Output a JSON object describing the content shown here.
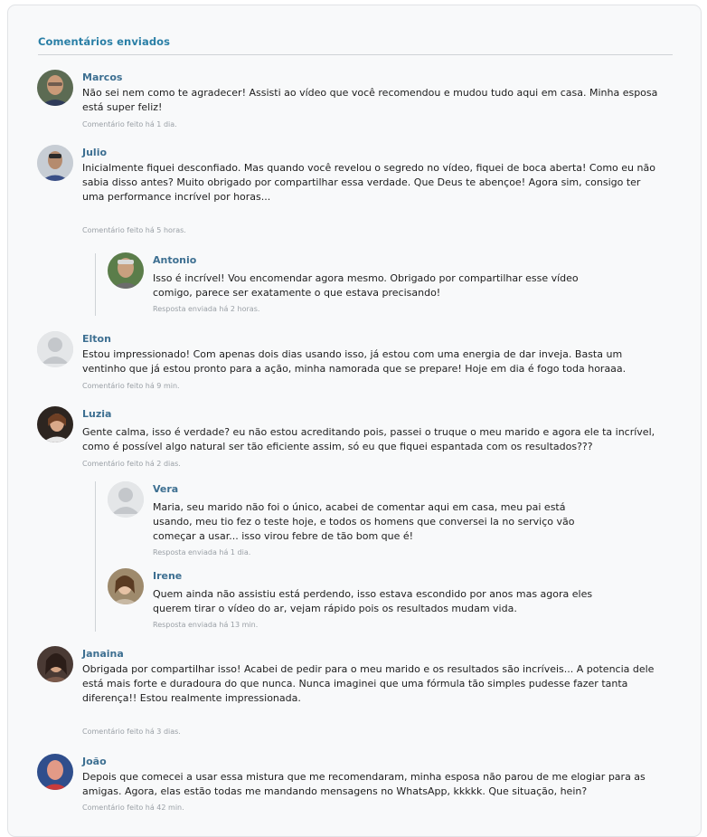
{
  "section_title": "Comentários enviados",
  "comments": [
    {
      "name": "Marcos",
      "text": "Não sei nem como te agradecer! Assisti ao vídeo que você recomendou e mudou tudo aqui em casa. Minha esposa está super feliz!",
      "meta": "Comentário feito há 1 dia."
    },
    {
      "name": "Julio",
      "text": "Inicialmente fiquei desconfiado. Mas quando você revelou o segredo no vídeo, fiquei de boca aberta! Como eu não sabia disso antes? Muito obrigado por compartilhar essa verdade. Que Deus te abençoe! Agora sim, consigo ter uma performance incrível por horas...",
      "meta": "Comentário feito há 5 horas.",
      "replies": [
        {
          "name": "Antonio",
          "text": "Isso é incrível! Vou encomendar agora mesmo. Obrigado por compartilhar esse vídeo comigo, parece ser exatamente o que estava precisando!",
          "meta": "Resposta enviada há 2 horas."
        }
      ]
    },
    {
      "name": "Elton",
      "text": "Estou impressionado! Com apenas dois dias usando isso, já estou com uma energia de dar inveja. Basta um ventinho que já estou pronto para a ação, minha namorada que se prepare! Hoje em dia é fogo toda horaaa.",
      "meta": "Comentário feito há 9 min."
    },
    {
      "name": "Luzia",
      "text": "Gente calma, isso é verdade? eu não estou acreditando pois, passei o truque o meu marido e agora ele ta incrível, como é possível algo natural ser tão eficiente assim, só eu que fiquei espantada com os resultados???",
      "meta": "Comentário feito há 2 dias.",
      "replies": [
        {
          "name": "Vera",
          "text": "Maria, seu marido não foi o único, acabei de comentar aqui em casa, meu pai está usando, meu tio fez o teste hoje, e todos os homens que conversei la no serviço vão começar a usar... isso virou febre de tão bom que é!",
          "meta": "Resposta enviada há 1 dia."
        },
        {
          "name": "Irene",
          "text": "Quem ainda não assistiu está perdendo, isso estava escondido por anos mas agora eles querem tirar o vídeo do ar, vejam rápido pois os resultados mudam vida.",
          "meta": "Resposta enviada há 13 min."
        }
      ]
    },
    {
      "name": "Janaina",
      "text": "Obrigada por compartilhar isso! Acabei de pedir para o meu marido e os resultados são incríveis... A potencia dele está mais forte e duradoura do que nunca. Nunca imaginei que uma fórmula tão simples pudesse fazer tanta diferença!! Estou realmente impressionada.",
      "meta": "Comentário feito há 3 dias."
    },
    {
      "name": "João",
      "text": "Depois que comecei a usar essa mistura que me recomendaram, minha esposa não parou de me elogiar para as amigas. Agora, elas estão todas me mandando mensagens no WhatsApp, kkkkk. Que situação, hein?",
      "meta": "Comentário feito há 42 min."
    }
  ]
}
